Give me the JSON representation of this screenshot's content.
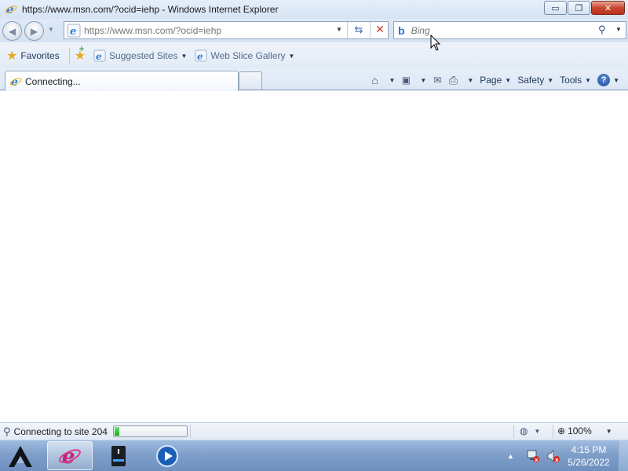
{
  "window": {
    "title": "https://www.msn.com/?ocid=iehp - Windows Internet Explorer",
    "minimize_label": "▭",
    "maximize_label": "❐",
    "close_label": "✕"
  },
  "address": {
    "url": "https://www.msn.com/?ocid=iehp"
  },
  "search": {
    "placeholder": "Bing",
    "provider_icon": "bing-icon"
  },
  "favorites_bar": {
    "favorites_label": "Favorites",
    "links": [
      {
        "label": "Suggested Sites",
        "icon": "ie-page-icon"
      },
      {
        "label": "Web Slice Gallery",
        "icon": "ie-page-icon"
      }
    ]
  },
  "tabs": [
    {
      "label": "Connecting...",
      "active": true
    }
  ],
  "command_bar": {
    "page_label": "Page",
    "safety_label": "Safety",
    "tools_label": "Tools",
    "help_label": "?"
  },
  "status": {
    "text": "Connecting to site 204",
    "progress_fraction": 0.06,
    "zoom": "100%"
  },
  "taskbar": {
    "apps": [
      {
        "name": "internet-explorer",
        "active": true
      },
      {
        "name": "file-storage",
        "active": false
      },
      {
        "name": "media-player",
        "active": false
      }
    ],
    "time": "4:15 PM",
    "date": "5/26/2022"
  },
  "colors": {
    "accent": "#1e75c6",
    "progress": "#1aa51a",
    "close_button": "#c7452f",
    "taskbar": "#7f9fc9"
  }
}
